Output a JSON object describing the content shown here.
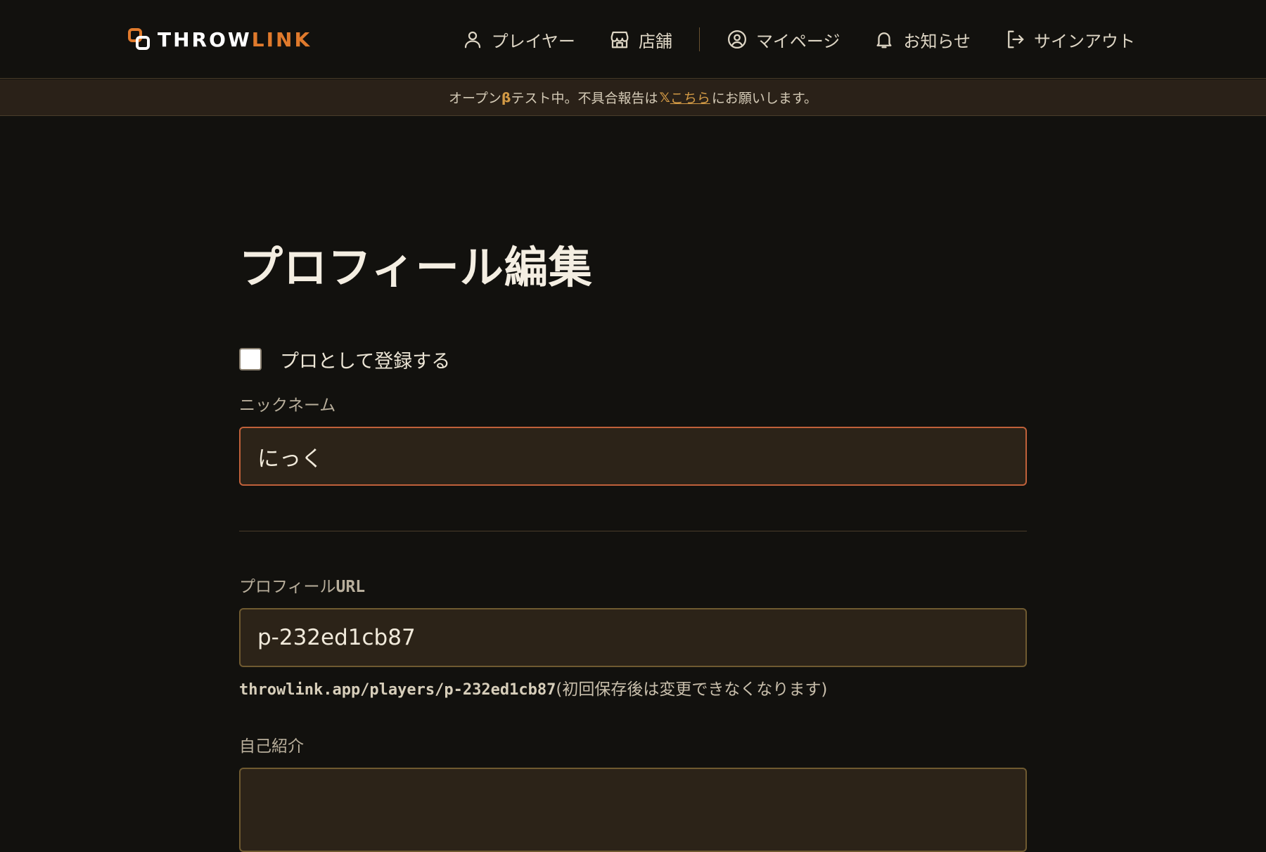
{
  "logo": {
    "brand_main": "THROW",
    "brand_accent": "LINK"
  },
  "nav": {
    "items": [
      {
        "label": "プレイヤー",
        "icon": "user-icon"
      },
      {
        "label": "店舗",
        "icon": "store-icon"
      },
      {
        "label": "マイページ",
        "icon": "user-circle-icon"
      },
      {
        "label": "お知らせ",
        "icon": "bell-icon"
      },
      {
        "label": "サインアウト",
        "icon": "sign-out-icon"
      }
    ]
  },
  "banner": {
    "text_before": "オープン",
    "beta": "β",
    "text_middle": "テスト中。不具合報告は",
    "x_symbol": "𝕏",
    "link_text": "こちら",
    "text_after": "にお願いします。"
  },
  "page": {
    "title": "プロフィール編集"
  },
  "form": {
    "pro_checkbox_label": "プロとして登録する",
    "pro_checked": false,
    "nickname_label": "ニックネーム",
    "nickname_value": "にっく",
    "url_label_prefix": "プロフィール",
    "url_label_suffix": "URL",
    "url_value": "p-232ed1cb87",
    "url_hint_url": "throwlink.app/players/p-232ed1cb87",
    "url_hint_note": "(初回保存後は変更できなくなります)",
    "bio_label": "自己紹介",
    "bio_value": ""
  },
  "colors": {
    "background": "#12110e",
    "accent": "#e07a2c",
    "link": "#d39a45",
    "focus_border": "#c0613a"
  }
}
